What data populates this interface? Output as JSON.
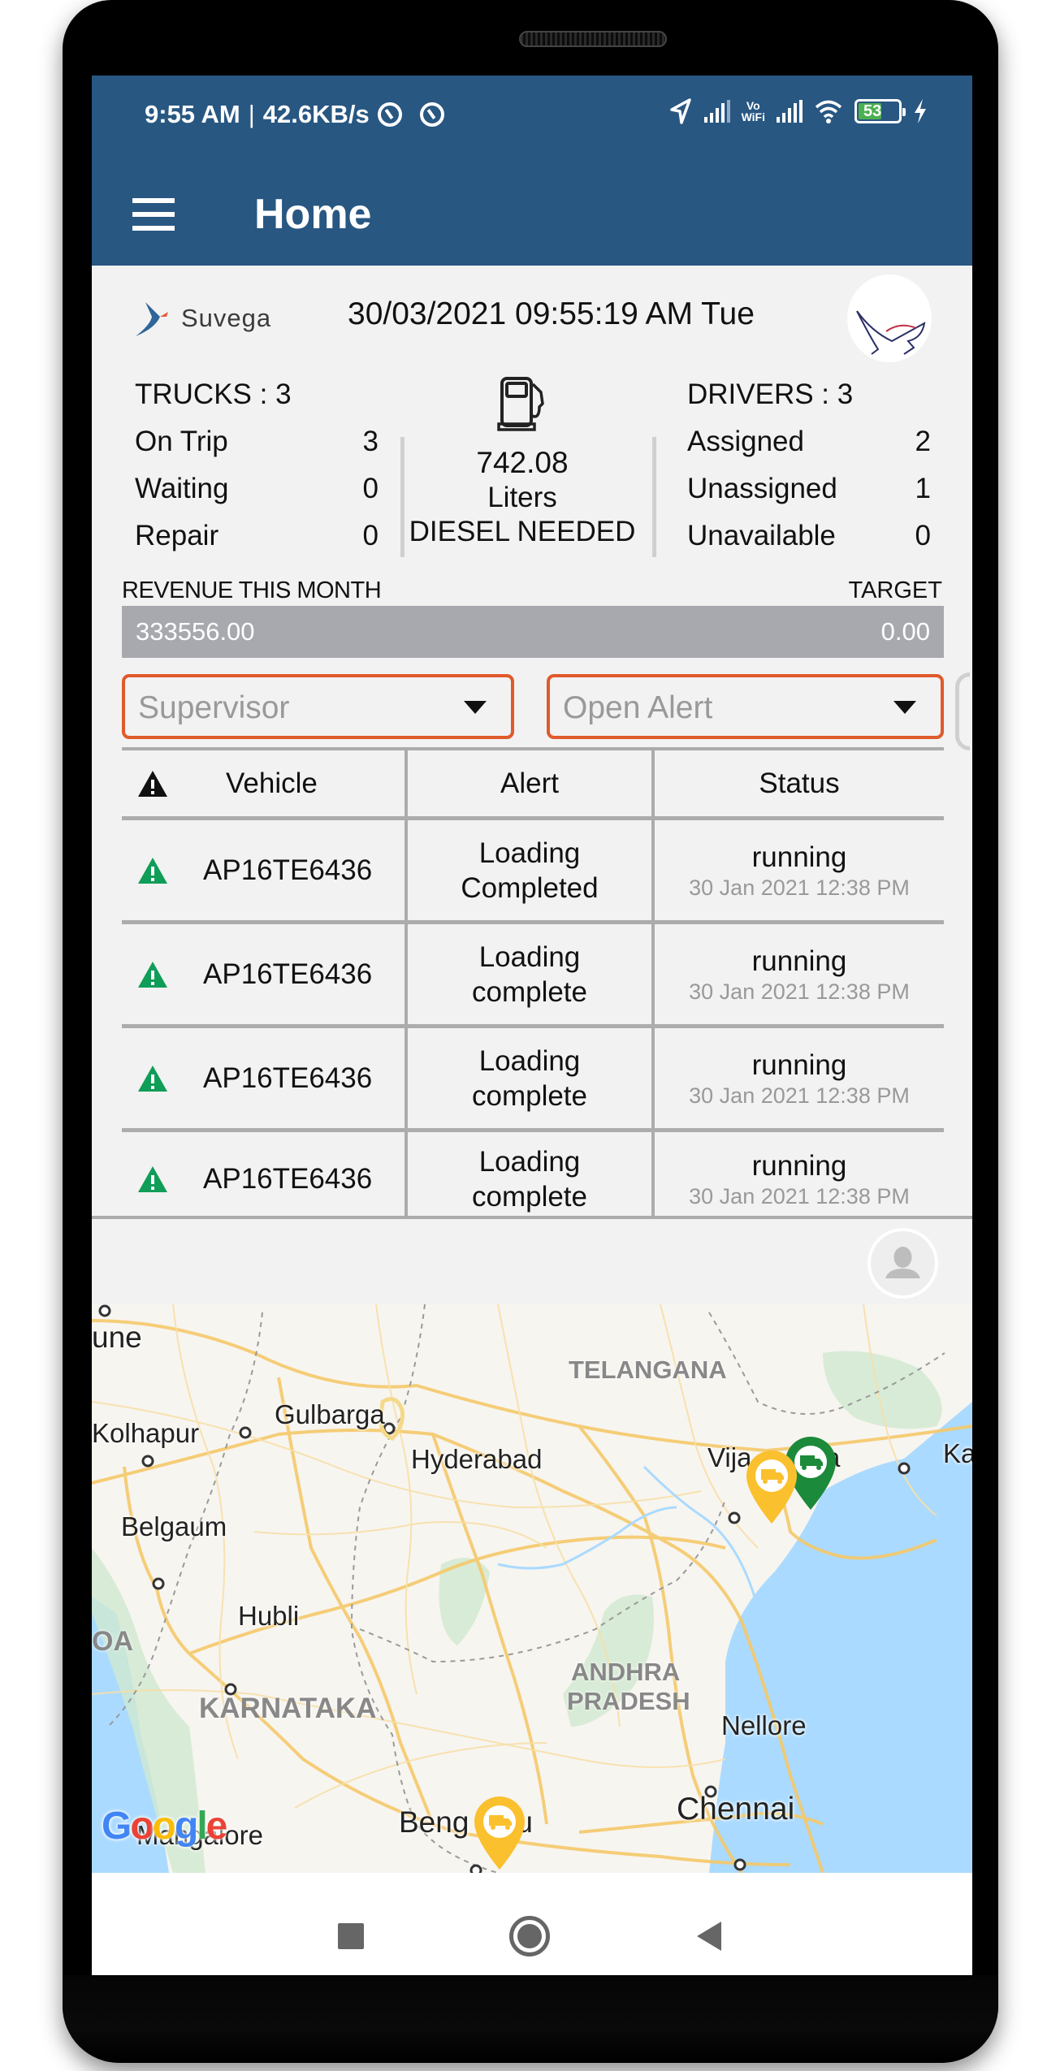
{
  "status_bar": {
    "time": "9:55 AM",
    "separator": "|",
    "network_speed": "42.6KB/s",
    "left_icons": [
      "data-saver-icon",
      "data-saver-icon"
    ],
    "right_icons": [
      "location-icon",
      "signal-icon",
      "vowifi-icon",
      "signal-icon",
      "wifi-icon",
      "battery-icon",
      "charging-icon"
    ],
    "vowifi_top": "Vo",
    "vowifi_bottom": "WiFi",
    "battery_level": "53",
    "battery_color": "#4caf50"
  },
  "app_bar": {
    "title": "Home",
    "menu_icon": "hamburger-menu-icon",
    "color": "#285782"
  },
  "header": {
    "logo_text": "Suvega",
    "datetime": "30/03/2021 09:55:19 AM Tue",
    "profile_icon": "company-avatar"
  },
  "trucks": {
    "title": "TRUCKS : 3",
    "rows": [
      {
        "label": "On Trip",
        "value": "3"
      },
      {
        "label": "Waiting",
        "value": "0"
      },
      {
        "label": "Repair",
        "value": "0"
      }
    ]
  },
  "diesel": {
    "icon": "fuel-pump-icon",
    "value": "742.08",
    "unit": "Liters",
    "label": "DIESEL NEEDED"
  },
  "drivers": {
    "title": "DRIVERS : 3",
    "rows": [
      {
        "label": "Assigned",
        "value": "2"
      },
      {
        "label": "Unassigned",
        "value": "1"
      },
      {
        "label": "Unavailable",
        "value": "0"
      }
    ]
  },
  "revenue": {
    "label": "REVENUE THIS MONTH",
    "target_label": "TARGET",
    "value": "333556.00",
    "target_value": "0.00",
    "progress_percent": 0
  },
  "filters": {
    "supervisor_placeholder": "Supervisor",
    "alert_filter_value": "Open Alert",
    "border_color": "#e05a2b"
  },
  "alerts_table": {
    "columns": [
      "Vehicle",
      "Alert",
      "Status"
    ],
    "header_icon": "warning-icon",
    "rows": [
      {
        "vehicle": "AP16TE6436",
        "alert_line1": "Loading",
        "alert_line2": "Completed",
        "status": "running",
        "time": "30 Jan 2021 12:38 PM",
        "icon_color": "#0f9d58"
      },
      {
        "vehicle": "AP16TE6436",
        "alert_line1": "Loading",
        "alert_line2": "complete",
        "status": "running",
        "time": "30 Jan 2021 12:38 PM",
        "icon_color": "#0f9d58"
      },
      {
        "vehicle": "AP16TE6436",
        "alert_line1": "Loading",
        "alert_line2": "complete",
        "status": "running",
        "time": "30 Jan 2021 12:38 PM",
        "icon_color": "#0f9d58"
      },
      {
        "vehicle": "AP16TE6436",
        "alert_line1": "Loading",
        "alert_line2": "complete",
        "status": "running",
        "time": "30 Jan 2021 12:38 PM",
        "icon_color": "#0f9d58"
      }
    ]
  },
  "map": {
    "cities": [
      "une",
      "Kolhapur",
      "Gulbarga",
      "Hyderabad",
      "Vija",
      "a",
      "Ka",
      "Belgaum",
      "Hubli",
      "Nellore",
      "Chennai",
      "Beng",
      "ru",
      "Mangalore",
      "OA"
    ],
    "states": [
      "TELANGANA",
      "KARNATAKA",
      "ANDHRA",
      "PRADESH"
    ],
    "markers": [
      {
        "name": "truck-marker",
        "color": "#fbc02d",
        "near": "Vijayawada"
      },
      {
        "name": "truck-marker",
        "color": "#1b8a3a",
        "near": "Vijayawada"
      },
      {
        "name": "truck-marker",
        "color": "#fbc02d",
        "near": "Bengaluru"
      }
    ],
    "attribution": "Google"
  },
  "nav_bar": {
    "buttons": [
      "recents-button",
      "home-button",
      "back-button"
    ]
  }
}
